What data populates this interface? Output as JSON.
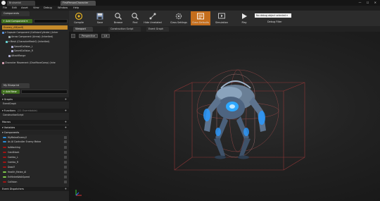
{
  "titlebar": {
    "tabs": [
      "Bruiserlot",
      "FirstPersonCharacter"
    ],
    "window_buttons": "— ☐ ✕"
  },
  "menu": [
    "File",
    "Edit",
    "Asset",
    "View",
    "Debug",
    "Window",
    "Help"
  ],
  "components_panel": {
    "tab_label": "Components",
    "add_component_label": "+ Add Component ▾",
    "selected_item": "Enemy_AR(self)",
    "tree": [
      "▾ Capsule Component (CollisionCylinder) (Inher",
      "Arrow Component (Arrow) (Inherited)",
      "▾ Mesh (CharacterMesh0) (Inherited)",
      "SwordCollision_L",
      "SwordCollision_R",
      "AttackRange",
      "Character Movement (CharMoveComp) (Inhe"
    ]
  },
  "my_blueprint": {
    "tab_label": "My Blueprint",
    "add_new_label": "+ Add New ▾",
    "sections": {
      "graphs": "▾ Graphs",
      "event_graph": "EventGraph",
      "functions": "▾ Functions",
      "functions_hint": "(21 Overridable)",
      "construction_script": "ConstructionScript",
      "macros": "Macros",
      "variables": "▾ Variables",
      "components": "▾ Components",
      "event_dispatchers": "Event Dispatchers"
    },
    "variables": [
      {
        "name": "MyMeleeEnemy2",
        "color": "#2e8cd6"
      },
      {
        "name": "As AI Controller Enemy Melee",
        "color": "#2e8cd6"
      },
      {
        "name": "IsAttacking",
        "color": "#a01414"
      },
      {
        "name": "CanAttack",
        "color": "#a01414"
      },
      {
        "name": "Combo_L",
        "color": "#a01414"
      },
      {
        "name": "Combo_R",
        "color": "#a01414"
      },
      {
        "name": "Dead?",
        "color": "#a01414"
      },
      {
        "name": "Health_Melee_AI",
        "color": "#7ec84a"
      },
      {
        "name": "EnMeleeWalkSpeed",
        "color": "#7ec84a"
      },
      {
        "name": "Collision",
        "color": "#a01414"
      }
    ]
  },
  "toolbar": {
    "buttons": [
      {
        "label": "Compile",
        "icon": "compile-icon"
      },
      {
        "label": "Save",
        "icon": "save-icon"
      },
      {
        "label": "Browse",
        "icon": "browse-icon"
      },
      {
        "label": "Find",
        "icon": "find-icon"
      },
      {
        "label": "Hide Unrelated",
        "icon": "hide-unrelated-icon"
      },
      {
        "label": "Class Settings",
        "icon": "class-settings-icon"
      },
      {
        "label": "Class Defaults",
        "icon": "class-defaults-icon"
      },
      {
        "label": "Simulation",
        "icon": "simulation-icon"
      },
      {
        "label": "Play",
        "icon": "play-icon"
      }
    ],
    "debug_select": "No debug object selected ▾",
    "debug_filter": "Debug Filter"
  },
  "editor_tabs": [
    "Viewport",
    "Construction Script",
    "Event Graph"
  ],
  "viewport": {
    "perspective_label": "Perspective",
    "lit_label": "Lit"
  },
  "colors": {
    "accent_orange": "#c56e1c",
    "add_green": "#3f6e1e",
    "selection": "#c58a2a"
  }
}
